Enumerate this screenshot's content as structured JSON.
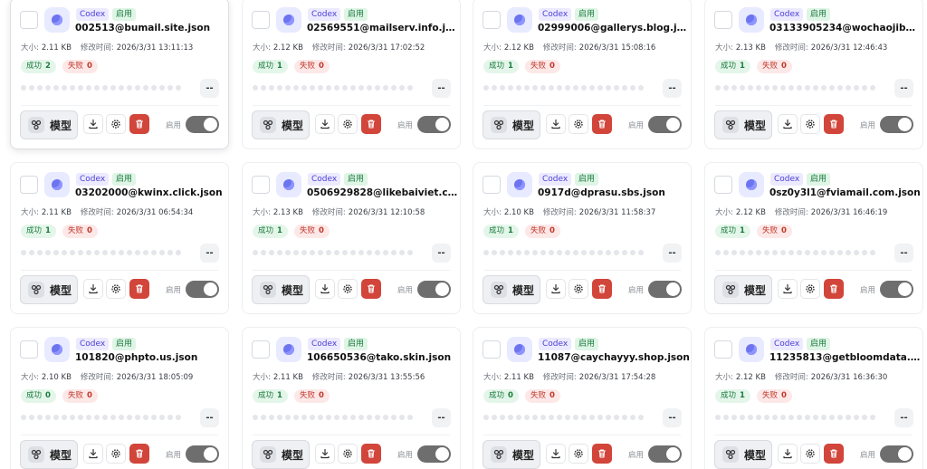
{
  "labels": {
    "codex": "Codex",
    "enabled": "启用",
    "size": "大小:",
    "modified": "修改时间:",
    "success": "成功",
    "fail": "失败",
    "dash": "--",
    "model": "模型",
    "toggle_label": "启用"
  },
  "files": [
    {
      "name": "002513@bumail.site.json",
      "size": "2.11 KB",
      "time": "2026/3/31 13:11:13",
      "success": "2",
      "fail": "0"
    },
    {
      "name": "02569551@mailserv.info.json",
      "size": "2.12 KB",
      "time": "2026/3/31 17:02:52",
      "success": "1",
      "fail": "0"
    },
    {
      "name": "02999006@gallerys.blog.json",
      "size": "2.12 KB",
      "time": "2026/3/31 15:08:16",
      "success": "1",
      "fail": "0"
    },
    {
      "name": "03133905234@wochaojiba...",
      "size": "2.13 KB",
      "time": "2026/3/31 12:46:43",
      "success": "1",
      "fail": "0"
    },
    {
      "name": "03202000@kwinx.click.json",
      "size": "2.11 KB",
      "time": "2026/3/31 06:54:34",
      "success": "1",
      "fail": "0"
    },
    {
      "name": "0506929828@likebaiviet.co...",
      "size": "2.13 KB",
      "time": "2026/3/31 12:10:58",
      "success": "1",
      "fail": "0"
    },
    {
      "name": "0917d@dprasu.sbs.json",
      "size": "2.10 KB",
      "time": "2026/3/31 11:58:37",
      "success": "1",
      "fail": "0"
    },
    {
      "name": "0sz0y3l1@fviamail.com.json",
      "size": "2.12 KB",
      "time": "2026/3/31 16:46:19",
      "success": "1",
      "fail": "0"
    },
    {
      "name": "101820@phpto.us.json",
      "size": "2.10 KB",
      "time": "2026/3/31 18:05:09",
      "success": "0",
      "fail": "0"
    },
    {
      "name": "106650536@tako.skin.json",
      "size": "2.11 KB",
      "time": "2026/3/31 13:55:56",
      "success": "1",
      "fail": "0"
    },
    {
      "name": "11087@caychayyy.shop.json",
      "size": "2.11 KB",
      "time": "2026/3/31 17:54:28",
      "success": "0",
      "fail": "0"
    },
    {
      "name": "11235813@getbloomdata.c...",
      "size": "2.12 KB",
      "time": "2026/3/31 16:36:30",
      "success": "1",
      "fail": "0"
    }
  ],
  "colors": {
    "codex_badge": "#eceaff",
    "enabled_badge": "#dff5e6",
    "delete_button": "#d2453a",
    "toggle_on": "#6e6e6e"
  },
  "icons": {
    "avatar": "openai-logo-icon",
    "model": "model-nodes-icon",
    "download": "download-icon",
    "settings": "gear-icon",
    "delete": "trash-icon"
  }
}
